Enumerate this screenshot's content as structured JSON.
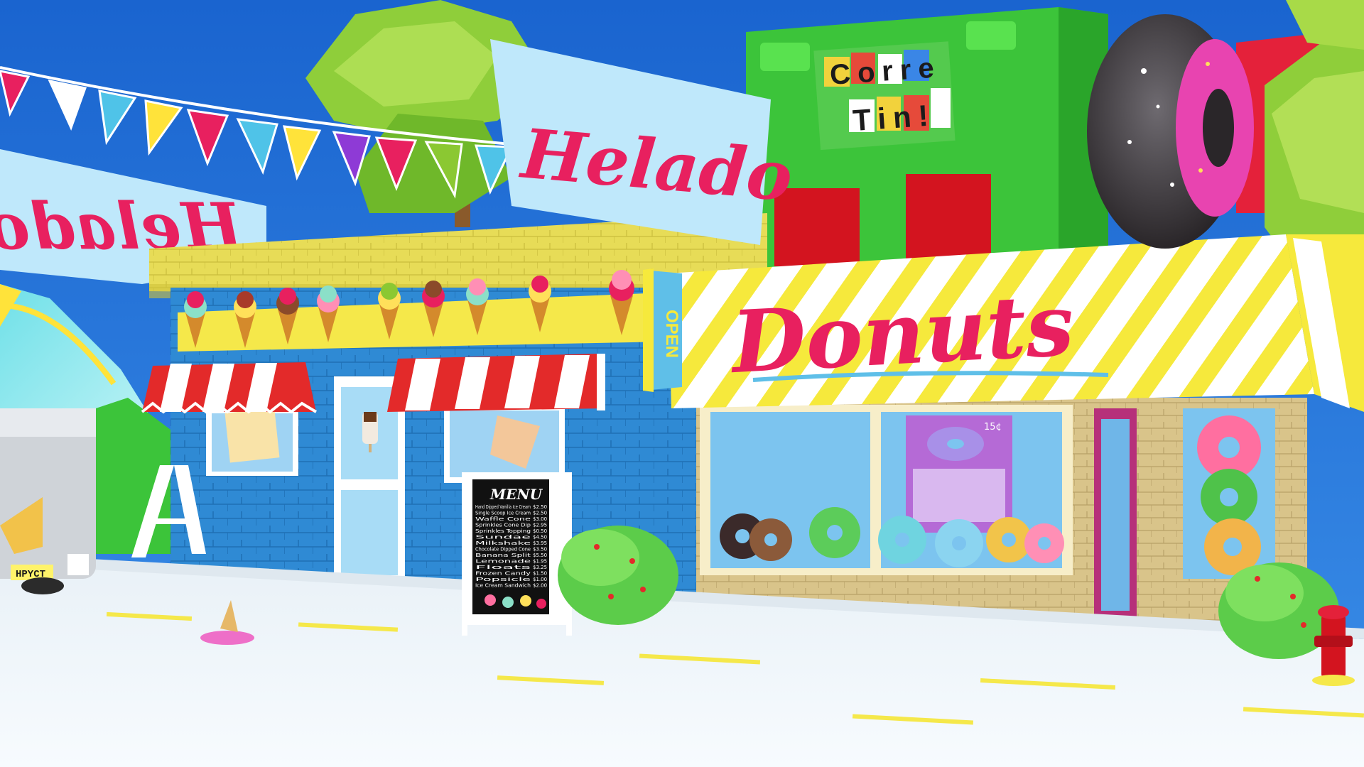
{
  "scene": {
    "type": "3d-street-storefronts",
    "sky_color": "#1b6fd6"
  },
  "signs": {
    "helado_main": "Helado",
    "helado_left": "Helado",
    "donuts": "Donuts",
    "corre_tin_line1": "Corre",
    "corre_tin_line2": "Tin!",
    "open_sign": "OPEN"
  },
  "menu_board": {
    "title": "MENU",
    "items": [
      {
        "name": "Hand Dipped Vanilla Ice Cream",
        "price": "$2.50"
      },
      {
        "name": "Single Scoop Ice Cream",
        "price": "$2.50"
      },
      {
        "name": "Waffle Cone",
        "price": "$3.00"
      },
      {
        "name": "Sprinkles Cone Dip",
        "price": "$2.95"
      },
      {
        "name": "Sprinkles Topping",
        "price": "$0.50"
      },
      {
        "name": "Sundae",
        "price": "$4.50"
      },
      {
        "name": "Milkshake",
        "price": "$3.95"
      },
      {
        "name": "Chocolate Dipped Cone",
        "price": "$3.50"
      },
      {
        "name": "Banana Split",
        "price": "$5.50"
      },
      {
        "name": "Lemonade",
        "price": "$1.95"
      },
      {
        "name": "Floats",
        "price": "$3.25"
      },
      {
        "name": "Frozen Candy",
        "price": "$1.50"
      },
      {
        "name": "Popsicle",
        "price": "$1.00"
      },
      {
        "name": "Ice Cream Sandwich",
        "price": "$2.00"
      }
    ]
  },
  "van": {
    "license_plate": "HPYCT"
  },
  "poster": {
    "price_tag": "15¢"
  },
  "colors": {
    "helado_pink": "#e8205f",
    "sign_bg": "#bfe8fb",
    "shop_blue": "#2f8fd8",
    "donut_yellow": "#f5e84a",
    "green_building": "#3cc43a",
    "awning_red": "#e32a2a",
    "tree_green": "#8bc832"
  }
}
